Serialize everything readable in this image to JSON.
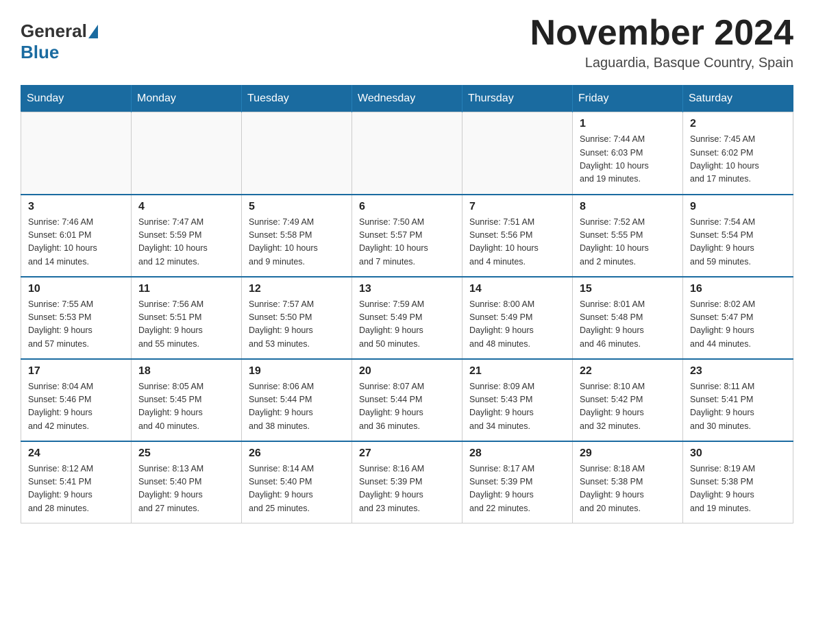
{
  "header": {
    "logo_general": "General",
    "logo_blue": "Blue",
    "month_title": "November 2024",
    "location": "Laguardia, Basque Country, Spain"
  },
  "days_of_week": [
    "Sunday",
    "Monday",
    "Tuesday",
    "Wednesday",
    "Thursday",
    "Friday",
    "Saturday"
  ],
  "weeks": [
    [
      {
        "day": "",
        "info": ""
      },
      {
        "day": "",
        "info": ""
      },
      {
        "day": "",
        "info": ""
      },
      {
        "day": "",
        "info": ""
      },
      {
        "day": "",
        "info": ""
      },
      {
        "day": "1",
        "info": "Sunrise: 7:44 AM\nSunset: 6:03 PM\nDaylight: 10 hours\nand 19 minutes."
      },
      {
        "day": "2",
        "info": "Sunrise: 7:45 AM\nSunset: 6:02 PM\nDaylight: 10 hours\nand 17 minutes."
      }
    ],
    [
      {
        "day": "3",
        "info": "Sunrise: 7:46 AM\nSunset: 6:01 PM\nDaylight: 10 hours\nand 14 minutes."
      },
      {
        "day": "4",
        "info": "Sunrise: 7:47 AM\nSunset: 5:59 PM\nDaylight: 10 hours\nand 12 minutes."
      },
      {
        "day": "5",
        "info": "Sunrise: 7:49 AM\nSunset: 5:58 PM\nDaylight: 10 hours\nand 9 minutes."
      },
      {
        "day": "6",
        "info": "Sunrise: 7:50 AM\nSunset: 5:57 PM\nDaylight: 10 hours\nand 7 minutes."
      },
      {
        "day": "7",
        "info": "Sunrise: 7:51 AM\nSunset: 5:56 PM\nDaylight: 10 hours\nand 4 minutes."
      },
      {
        "day": "8",
        "info": "Sunrise: 7:52 AM\nSunset: 5:55 PM\nDaylight: 10 hours\nand 2 minutes."
      },
      {
        "day": "9",
        "info": "Sunrise: 7:54 AM\nSunset: 5:54 PM\nDaylight: 9 hours\nand 59 minutes."
      }
    ],
    [
      {
        "day": "10",
        "info": "Sunrise: 7:55 AM\nSunset: 5:53 PM\nDaylight: 9 hours\nand 57 minutes."
      },
      {
        "day": "11",
        "info": "Sunrise: 7:56 AM\nSunset: 5:51 PM\nDaylight: 9 hours\nand 55 minutes."
      },
      {
        "day": "12",
        "info": "Sunrise: 7:57 AM\nSunset: 5:50 PM\nDaylight: 9 hours\nand 53 minutes."
      },
      {
        "day": "13",
        "info": "Sunrise: 7:59 AM\nSunset: 5:49 PM\nDaylight: 9 hours\nand 50 minutes."
      },
      {
        "day": "14",
        "info": "Sunrise: 8:00 AM\nSunset: 5:49 PM\nDaylight: 9 hours\nand 48 minutes."
      },
      {
        "day": "15",
        "info": "Sunrise: 8:01 AM\nSunset: 5:48 PM\nDaylight: 9 hours\nand 46 minutes."
      },
      {
        "day": "16",
        "info": "Sunrise: 8:02 AM\nSunset: 5:47 PM\nDaylight: 9 hours\nand 44 minutes."
      }
    ],
    [
      {
        "day": "17",
        "info": "Sunrise: 8:04 AM\nSunset: 5:46 PM\nDaylight: 9 hours\nand 42 minutes."
      },
      {
        "day": "18",
        "info": "Sunrise: 8:05 AM\nSunset: 5:45 PM\nDaylight: 9 hours\nand 40 minutes."
      },
      {
        "day": "19",
        "info": "Sunrise: 8:06 AM\nSunset: 5:44 PM\nDaylight: 9 hours\nand 38 minutes."
      },
      {
        "day": "20",
        "info": "Sunrise: 8:07 AM\nSunset: 5:44 PM\nDaylight: 9 hours\nand 36 minutes."
      },
      {
        "day": "21",
        "info": "Sunrise: 8:09 AM\nSunset: 5:43 PM\nDaylight: 9 hours\nand 34 minutes."
      },
      {
        "day": "22",
        "info": "Sunrise: 8:10 AM\nSunset: 5:42 PM\nDaylight: 9 hours\nand 32 minutes."
      },
      {
        "day": "23",
        "info": "Sunrise: 8:11 AM\nSunset: 5:41 PM\nDaylight: 9 hours\nand 30 minutes."
      }
    ],
    [
      {
        "day": "24",
        "info": "Sunrise: 8:12 AM\nSunset: 5:41 PM\nDaylight: 9 hours\nand 28 minutes."
      },
      {
        "day": "25",
        "info": "Sunrise: 8:13 AM\nSunset: 5:40 PM\nDaylight: 9 hours\nand 27 minutes."
      },
      {
        "day": "26",
        "info": "Sunrise: 8:14 AM\nSunset: 5:40 PM\nDaylight: 9 hours\nand 25 minutes."
      },
      {
        "day": "27",
        "info": "Sunrise: 8:16 AM\nSunset: 5:39 PM\nDaylight: 9 hours\nand 23 minutes."
      },
      {
        "day": "28",
        "info": "Sunrise: 8:17 AM\nSunset: 5:39 PM\nDaylight: 9 hours\nand 22 minutes."
      },
      {
        "day": "29",
        "info": "Sunrise: 8:18 AM\nSunset: 5:38 PM\nDaylight: 9 hours\nand 20 minutes."
      },
      {
        "day": "30",
        "info": "Sunrise: 8:19 AM\nSunset: 5:38 PM\nDaylight: 9 hours\nand 19 minutes."
      }
    ]
  ]
}
